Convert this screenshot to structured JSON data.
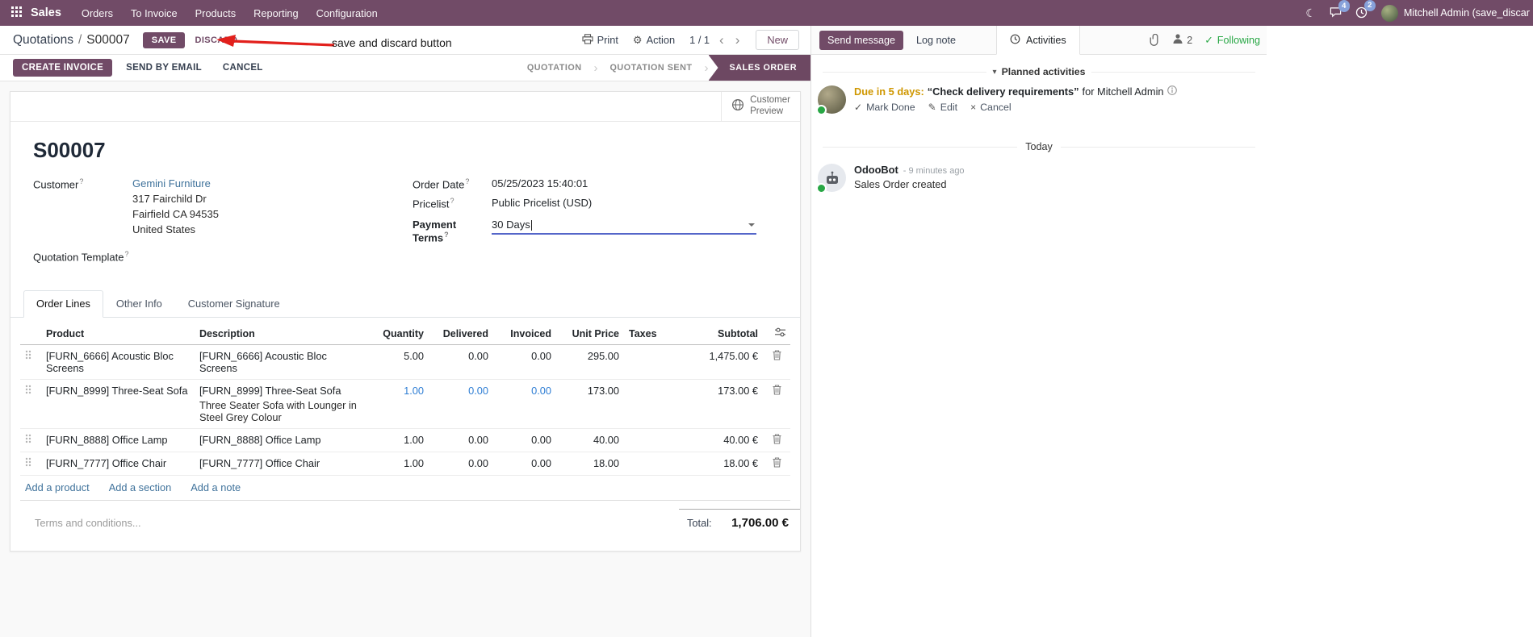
{
  "colors": {
    "brand": "#714B67",
    "active_step_bg": "#6d4862",
    "link": "#3f729b",
    "edited_value": "#2f7ed4",
    "due_warning": "#cf9700",
    "success": "#28a745",
    "annotation": "#e2201c",
    "navbar_badge": "#87a1da"
  },
  "glyphs": {
    "moon": "☾",
    "gear": "⚙",
    "chevron_left": "‹",
    "chevron_right": "›",
    "caret_down": "▾",
    "check": "✓",
    "pencil": "✎",
    "cross": "×",
    "help": "?",
    "slash": "/"
  },
  "navbar": {
    "app": "Sales",
    "menus": [
      "Orders",
      "To Invoice",
      "Products",
      "Reporting",
      "Configuration"
    ],
    "message_badge": "4",
    "activity_badge": "2",
    "user_name": "Mitchell Admin (save_discar"
  },
  "breadcrumb": {
    "parent": "Quotations",
    "current": "S00007"
  },
  "control": {
    "save": "SAVE",
    "discard": "DISCARD",
    "print": "Print",
    "action": "Action",
    "pager": "1 / 1",
    "new": "New"
  },
  "annotation": {
    "text": "save and discard button"
  },
  "statusbar": {
    "buttons": [
      "CREATE INVOICE",
      "SEND BY EMAIL",
      "CANCEL"
    ],
    "steps": [
      {
        "label": "QUOTATION",
        "active": false
      },
      {
        "label": "QUOTATION SENT",
        "active": false
      },
      {
        "label": "SALES ORDER",
        "active": true
      }
    ]
  },
  "sheet": {
    "customer_preview": {
      "line1": "Customer",
      "line2": "Preview"
    },
    "title": "S00007",
    "fields": {
      "customer_label": "Customer",
      "customer_name": "Gemini Furniture",
      "address": [
        "317 Fairchild Dr",
        "Fairfield CA 94535",
        "United States"
      ],
      "quotation_template_label": "Quotation Template",
      "order_date_label": "Order Date",
      "order_date_value": "05/25/2023 15:40:01",
      "pricelist_label": "Pricelist",
      "pricelist_value": "Public Pricelist (USD)",
      "payment_terms_label": "Payment Terms",
      "payment_terms_value": "30 Days"
    },
    "tabs": [
      "Order Lines",
      "Other Info",
      "Customer Signature"
    ],
    "table": {
      "headers": [
        "Product",
        "Description",
        "Quantity",
        "Delivered",
        "Invoiced",
        "Unit Price",
        "Taxes",
        "Subtotal"
      ],
      "rows": [
        {
          "product": "[FURN_6666] Acoustic Bloc Screens",
          "description": "[FURN_6666] Acoustic Bloc Screens",
          "description2": "",
          "quantity": "5.00",
          "delivered": "0.00",
          "invoiced": "0.00",
          "unit_price": "295.00",
          "taxes": "",
          "subtotal": "1,475.00 €"
        },
        {
          "product": "[FURN_8999] Three-Seat Sofa",
          "description": "[FURN_8999] Three-Seat Sofa",
          "description2": "Three Seater Sofa with Lounger in Steel Grey Colour",
          "quantity": "1.00",
          "delivered": "0.00",
          "invoiced": "0.00",
          "unit_price": "173.00",
          "taxes": "",
          "subtotal": "173.00 €"
        },
        {
          "product": "[FURN_8888] Office Lamp",
          "description": "[FURN_8888] Office Lamp",
          "description2": "",
          "quantity": "1.00",
          "delivered": "0.00",
          "invoiced": "0.00",
          "unit_price": "40.00",
          "taxes": "",
          "subtotal": "40.00 €"
        },
        {
          "product": "[FURN_7777] Office Chair",
          "description": "[FURN_7777] Office Chair",
          "description2": "",
          "quantity": "1.00",
          "delivered": "0.00",
          "invoiced": "0.00",
          "unit_price": "18.00",
          "taxes": "",
          "subtotal": "18.00 €"
        }
      ],
      "links": [
        "Add a product",
        "Add a section",
        "Add a note"
      ]
    },
    "terms_placeholder": "Terms and conditions...",
    "total_label": "Total:",
    "total_value": "1,706.00 €"
  },
  "chatter": {
    "send_message": "Send message",
    "log_note": "Log note",
    "activities_tab": "Activities",
    "followers_count": "2",
    "following": "Following",
    "planned_header": "Planned activities",
    "activity": {
      "due": "Due in 5 days:",
      "summary": "“Check delivery requirements”",
      "assignee": "for Mitchell Admin",
      "mark_done": "Mark Done",
      "edit": "Edit",
      "cancel": "Cancel"
    },
    "today": "Today",
    "message": {
      "author": "OdooBot",
      "time": "- 9 minutes ago",
      "body": "Sales Order created"
    }
  }
}
